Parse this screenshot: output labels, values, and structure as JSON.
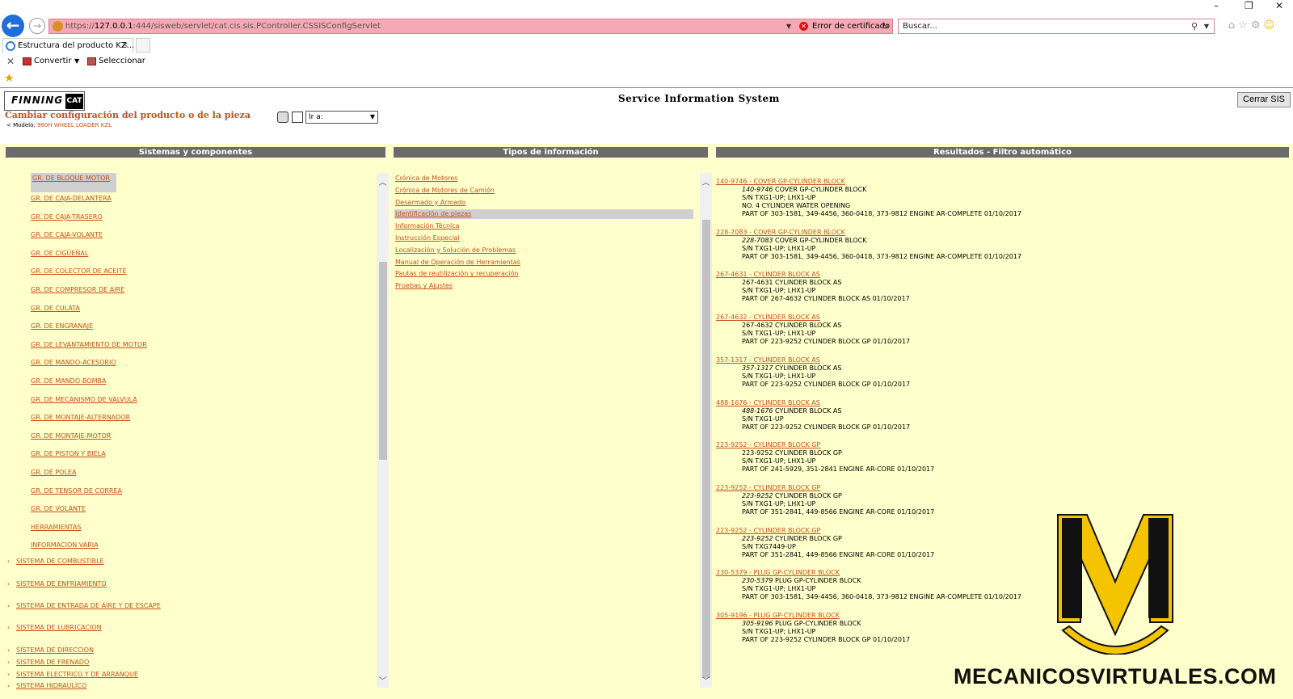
{
  "browser": {
    "url_prefix": "https://",
    "url_host": "127.0.0.1",
    "url_rest": ":444/sisweb/servlet/cat.cis.sis.PController.CSSISConfigServlet",
    "cert_error": "Error de certificado",
    "search_placeholder": "Buscar...",
    "tab_title": "Estructura del producto KZ...",
    "cmd_convert": "Convertir",
    "cmd_select": "Seleccionar"
  },
  "header": {
    "logo_text": "FINNING",
    "logo_cat": "CAT",
    "title": "Service Information System",
    "close_button": "Cerrar SIS",
    "config_title": "Cambiar configuración del producto o de la pieza",
    "model_label": "Modelo:",
    "model_value": "980H WHEEL LOADER KZL",
    "goto_label": "Ir a:"
  },
  "panels": {
    "systems_title": "Sistemas y componentes",
    "info_title": "Tipos de información",
    "results_title": "Resultados - Filtro automático"
  },
  "systems": {
    "selected": "GR. DE BLOQUE MOTOR",
    "sub_items": [
      "GR. DE CAJA-DELANTERA",
      "GR. DE CAJA-TRASERO",
      "GR. DE CAJA-VOLANTE",
      "GR. DE CIGÜEÑAL",
      "GR. DE COLECTOR DE ACEITE",
      "GR. DE COMPRESOR DE AIRE",
      "GR. DE CULATA",
      "GR. DE ENGRANAJE",
      "GR. DE LEVANTAMIENTO DE MOTOR",
      "GR. DE MANDO-ACESORIO",
      "GR. DE MANDO-BOMBA",
      "GR. DE MECANISMO DE VALVULA",
      "GR. DE MONTAJE-ALTERNADOR",
      "GR. DE MONTAJE-MOTOR",
      "GR. DE PISTON Y BIELA",
      "GR. DE POLEA",
      "GR. DE TENSOR DE CORREA",
      "GR. DE VOLANTE",
      "HERRAMIENTAS",
      "INFORMACION VARIA"
    ],
    "top_items": [
      "SISTEMA DE COMBUSTIBLE",
      "SISTEMA DE ENFRIAMIENTO",
      "SISTEMA DE ENTRADA DE AIRE Y DE ESCAPE",
      "SISTEMA DE LUBRICACION",
      "SISTEMA DE DIRECCION",
      "SISTEMA DE FRENADO",
      "SISTEMA ELECTRICO Y DE ARRANQUE",
      "SISTEMA HIDRAULICO"
    ]
  },
  "info_types": {
    "selected_index": 3,
    "items": [
      "Crónica de Motores",
      "Crónica de Motores de Camión",
      "Desarmado y Armado",
      "Identificación de piezas",
      "Información Técnica",
      "Instrucción Especial",
      "Localización y Solución de Problemas",
      "Manual de Operación de Herramientas",
      "Pautas de reutilización y recuperación",
      "Pruebas y Ajustes"
    ]
  },
  "results": [
    {
      "link": "140-9746 - COVER GP-CYLINDER BLOCK",
      "pn": "140-9746",
      "desc": " COVER GP-CYLINDER BLOCK",
      "lines": [
        "S/N TXG1-UP; LHX1-UP",
        "NO. 4 CYLINDER WATER OPENING",
        "PART OF 303-1581, 349-4456, 360-0418, 373-9812 ENGINE AR-COMPLETE 01/10/2017"
      ]
    },
    {
      "link": "228-7083 - COVER GP-CYLINDER BLOCK",
      "pn": "228-7083",
      "desc": " COVER GP-CYLINDER BLOCK",
      "lines": [
        "S/N TXG1-UP; LHX1-UP",
        "PART OF 303-1581, 349-4456, 360-0418, 373-9812 ENGINE AR-COMPLETE 01/10/2017"
      ]
    },
    {
      "link": "267-4631 - CYLINDER BLOCK AS",
      "pn": "",
      "desc": "267-4631 CYLINDER BLOCK AS",
      "lines": [
        "S/N TXG1-UP; LHX1-UP",
        "PART OF 267-4632 CYLINDER BLOCK AS 01/10/2017"
      ]
    },
    {
      "link": "267-4632 - CYLINDER BLOCK AS",
      "pn": "",
      "desc": "267-4632 CYLINDER BLOCK AS",
      "lines": [
        "S/N TXG1-UP; LHX1-UP",
        "PART OF 223-9252 CYLINDER BLOCK GP 01/10/2017"
      ]
    },
    {
      "link": "357-1317 - CYLINDER BLOCK AS",
      "pn": "357-1317",
      "desc": " CYLINDER BLOCK AS",
      "lines": [
        "S/N TXG1-UP; LHX1-UP",
        "PART OF 223-9252 CYLINDER BLOCK GP 01/10/2017"
      ]
    },
    {
      "link": "488-1676 - CYLINDER BLOCK AS",
      "pn": "488-1676",
      "desc": " CYLINDER BLOCK AS",
      "lines": [
        "S/N TXG1-UP",
        "PART OF 223-9252 CYLINDER BLOCK GP 01/10/2017"
      ]
    },
    {
      "link": "223-9252 - CYLINDER BLOCK GP",
      "pn": "",
      "desc": "223-9252 CYLINDER BLOCK GP",
      "lines": [
        "S/N TXG1-UP; LHX1-UP",
        "PART OF 241-5929, 351-2841 ENGINE AR-CORE 01/10/2017"
      ]
    },
    {
      "link": "223-9252 - CYLINDER BLOCK GP",
      "pn": "223-9252",
      "desc": " CYLINDER BLOCK GP",
      "lines": [
        "S/N TXG1-UP; LHX1-UP",
        "PART OF 351-2841, 449-8566 ENGINE AR-CORE 01/10/2017"
      ]
    },
    {
      "link": "223-9252 - CYLINDER BLOCK GP",
      "pn": "223-9252",
      "desc": " CYLINDER BLOCK GP",
      "lines": [
        "S/N TXG7449-UP",
        "PART OF 351-2841, 449-8566 ENGINE AR-CORE 01/10/2017"
      ]
    },
    {
      "link": "230-5379 - PLUG GP-CYLINDER BLOCK",
      "pn": "230-5379",
      "desc": " PLUG GP-CYLINDER BLOCK",
      "lines": [
        "S/N TXG1-UP; LHX1-UP",
        "PART OF 303-1581, 349-4456, 360-0418, 373-9812 ENGINE AR-COMPLETE 01/10/2017"
      ]
    },
    {
      "link": "305-9196 - PLUG GP-CYLINDER BLOCK",
      "pn": "305-9196",
      "desc": " PLUG GP-CYLINDER BLOCK",
      "lines": [
        "S/N TXG1-UP; LHX1-UP",
        "PART OF 223-9252 CYLINDER BLOCK GP 01/10/2017"
      ]
    }
  ],
  "watermark": "MECANICOSVIRTUALES.COM",
  "colors": {
    "link": "#c8501a",
    "panel_bg": "#ffffcc",
    "panel_header": "#6b6b6b",
    "address_error": "#f4a9b4"
  }
}
